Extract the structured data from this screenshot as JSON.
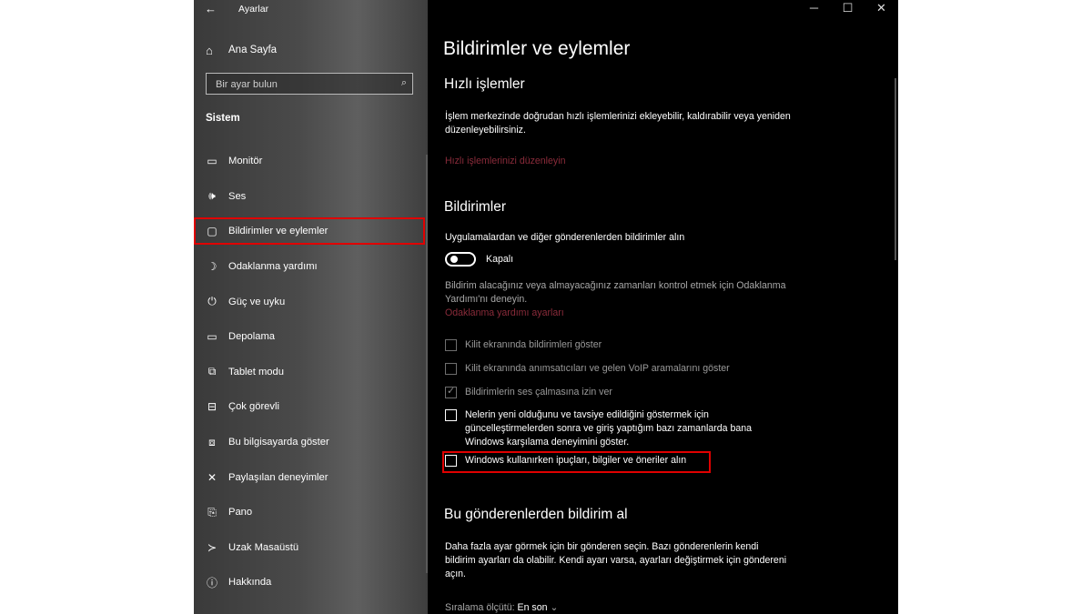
{
  "window": {
    "title": "Ayarlar",
    "back_icon": "←"
  },
  "sidebar": {
    "home_label": "Ana Sayfa",
    "search_placeholder": "Bir ayar bulun",
    "section_title": "Sistem",
    "items": [
      {
        "label": "Monitör",
        "icon": "monitor-icon",
        "glyph": "▭"
      },
      {
        "label": "Ses",
        "icon": "speaker-icon",
        "glyph": "🕪"
      },
      {
        "label": "Bildirimler ve eylemler",
        "icon": "notification-icon",
        "glyph": "▢",
        "active": true
      },
      {
        "label": "Odaklanma yardımı",
        "icon": "moon-icon",
        "glyph": "☽"
      },
      {
        "label": "Güç ve uyku",
        "icon": "power-icon",
        "glyph": "⏻"
      },
      {
        "label": "Depolama",
        "icon": "storage-icon",
        "glyph": "▭"
      },
      {
        "label": "Tablet modu",
        "icon": "tablet-icon",
        "glyph": "⧉"
      },
      {
        "label": "Çok görevli",
        "icon": "multitasking-icon",
        "glyph": "⊟"
      },
      {
        "label": "Bu bilgisayarda göster",
        "icon": "project-icon",
        "glyph": "⧈"
      },
      {
        "label": "Paylaşılan deneyimler",
        "icon": "shared-icon",
        "glyph": "✕"
      },
      {
        "label": "Pano",
        "icon": "clipboard-icon",
        "glyph": "⎘"
      },
      {
        "label": "Uzak Masaüstü",
        "icon": "remote-desktop-icon",
        "glyph": "≻"
      },
      {
        "label": "Hakkında",
        "icon": "info-icon",
        "glyph": "ⓘ"
      }
    ]
  },
  "content": {
    "page_title": "Bildirimler ve eylemler",
    "quick": {
      "heading": "Hızlı işlemler",
      "desc": "İşlem merkezinde doğrudan hızlı işlemlerinizi ekleyebilir, kaldırabilir veya yeniden düzenleyebilirsiniz.",
      "link": "Hızlı işlemlerinizi düzenleyin"
    },
    "notifications": {
      "heading": "Bildirimler",
      "toggle_title": "Uygulamalardan ve diğer gönderenlerden bildirimler alın",
      "toggle_state": "Kapalı",
      "focus_desc": "Bildirim alacağınız veya almayacağınız zamanları kontrol etmek için Odaklanma Yardımı'nı deneyin.",
      "focus_link": "Odaklanma yardımı ayarları",
      "checkboxes": [
        {
          "label": "Kilit ekranında bildirimleri göster",
          "checked": false,
          "disabled": true
        },
        {
          "label": "Kilit ekranında anımsatıcıları ve gelen VoIP aramalarını göster",
          "checked": false,
          "disabled": true
        },
        {
          "label": "Bildirimlerin ses çalmasına izin ver",
          "checked": true,
          "disabled": true
        },
        {
          "label": "Nelerin yeni olduğunu ve tavsiye edildiğini göstermek için güncelleştirmelerden sonra ve giriş yaptığım bazı zamanlarda bana Windows karşılama deneyimini göster.",
          "checked": false,
          "disabled": false
        },
        {
          "label": "Windows kullanırken ipuçları, bilgiler ve öneriler alın",
          "checked": false,
          "disabled": false
        }
      ]
    },
    "senders": {
      "heading": "Bu gönderenlerden bildirim al",
      "desc": "Daha fazla ayar görmek için bir gönderen seçin. Bazı gönderenlerin kendi bildirim ayarları da olabilir. Kendi ayarı varsa, ayarları değiştirmek için göndereni açın.",
      "sort_label": "Sıralama ölçütü:",
      "sort_value": "En son"
    }
  },
  "colors": {
    "highlight": "#e00000",
    "link": "#8a2b3a"
  }
}
